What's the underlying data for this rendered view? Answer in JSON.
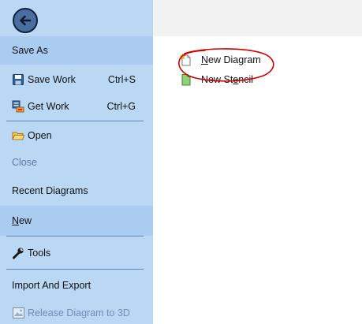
{
  "sidebar": {
    "back_icon": "back-arrow-icon",
    "items": {
      "save_as": {
        "label": "Save As"
      },
      "save_work": {
        "label": "Save Work",
        "shortcut": "Ctrl+S",
        "icon": "floppy-disk-icon"
      },
      "get_work": {
        "label": "Get Work",
        "shortcut": "Ctrl+G",
        "icon": "server-download-icon"
      },
      "open": {
        "label": "Open",
        "icon": "folder-icon"
      },
      "close": {
        "label": "Close"
      },
      "recent": {
        "label": "Recent Diagrams"
      },
      "new": {
        "label_underlined": "N",
        "label_rest": "ew"
      },
      "tools": {
        "label": "Tools",
        "icon": "wrench-icon"
      },
      "import_export": {
        "label": "Import And Export"
      },
      "release_3d": {
        "label": "Release Diagram to 3D",
        "icon": "picture-icon"
      }
    }
  },
  "content": {
    "new_diagram": {
      "u": "N",
      "rest": "ew Diagram",
      "icon": "new-document-icon"
    },
    "new_stencil": {
      "pre": "New St",
      "u": "e",
      "rest": "ncil",
      "icon": "green-document-icon"
    }
  },
  "colors": {
    "sidebar_bg": "#bad7f4",
    "selected_bg": "#a9ccf0",
    "annotation_red": "#d40000"
  }
}
